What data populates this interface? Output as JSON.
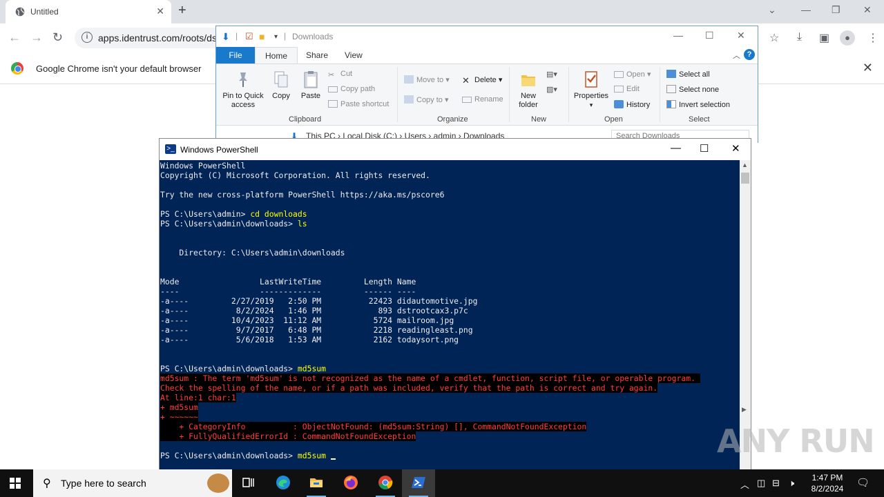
{
  "chrome": {
    "tab_title": "Untitled",
    "url": "apps.identrust.com/roots/ds",
    "infobar_message": "Google Chrome isn't your default browser"
  },
  "explorer": {
    "title": "Downloads",
    "tabs": {
      "file": "File",
      "home": "Home",
      "share": "Share",
      "view": "View"
    },
    "ribbon": {
      "clipboard": {
        "label": "Clipboard",
        "pin": "Pin to Quick access",
        "copy": "Copy",
        "paste": "Paste",
        "cut": "Cut",
        "copy_path": "Copy path",
        "paste_shortcut": "Paste shortcut"
      },
      "organize": {
        "label": "Organize",
        "move_to": "Move to",
        "copy_to": "Copy to",
        "delete": "Delete",
        "rename": "Rename"
      },
      "new": {
        "label": "New",
        "new_folder": "New folder"
      },
      "open": {
        "label": "Open",
        "properties": "Properties",
        "open": "Open",
        "edit": "Edit",
        "history": "History"
      },
      "select": {
        "label": "Select",
        "select_all": "Select all",
        "select_none": "Select none",
        "invert": "Invert selection"
      }
    },
    "address": "This PC  ›  Local Disk (C:)  ›  Users  ›  admin  ›  Downloads",
    "search_placeholder": "Search Downloads"
  },
  "powershell": {
    "title": "Windows PowerShell",
    "lines": [
      {
        "t": "Windows PowerShell"
      },
      {
        "t": "Copyright (C) Microsoft Corporation. All rights reserved."
      },
      {
        "t": ""
      },
      {
        "t": "Try the new cross-platform PowerShell https://aka.ms/pscore6"
      },
      {
        "t": ""
      },
      {
        "t": "PS C:\\Users\\admin> ",
        "c": "cd downloads"
      },
      {
        "t": "PS C:\\Users\\admin\\downloads> ",
        "c": "ls"
      },
      {
        "t": ""
      },
      {
        "t": ""
      },
      {
        "t": "    Directory: C:\\Users\\admin\\downloads"
      },
      {
        "t": ""
      },
      {
        "t": ""
      },
      {
        "t": "Mode                 LastWriteTime         Length Name"
      },
      {
        "t": "----                 -------------         ------ ----"
      },
      {
        "t": "-a----         2/27/2019   2:50 PM          22423 didautomotive.jpg"
      },
      {
        "t": "-a----          8/2/2024   1:46 PM            893 dstrootcax3.p7c"
      },
      {
        "t": "-a----         10/4/2023  11:12 AM           5724 mailroom.jpg"
      },
      {
        "t": "-a----          9/7/2017   6:48 PM           2218 readingleast.png"
      },
      {
        "t": "-a----          5/6/2018   1:53 AM           2162 todaysort.png"
      },
      {
        "t": ""
      },
      {
        "t": ""
      },
      {
        "t": "PS C:\\Users\\admin\\downloads> ",
        "c": "md5sum"
      },
      {
        "e": "md5sum : The term 'md5sum' is not recognized as the name of a cmdlet, function, script file, or operable program. "
      },
      {
        "e": "Check the spelling of the name, or if a path was included, verify that the path is correct and try again."
      },
      {
        "e": "At line:1 char:1"
      },
      {
        "e": "+ md5sum"
      },
      {
        "e": "+ ~~~~~~"
      },
      {
        "e": "    + CategoryInfo          : ObjectNotFound: (md5sum:String) [], CommandNotFoundException"
      },
      {
        "e": "    + FullyQualifiedErrorId : CommandNotFoundException"
      },
      {
        "t": ""
      },
      {
        "t": "PS C:\\Users\\admin\\downloads> ",
        "c": "md5sum ",
        "cursor": true
      }
    ]
  },
  "taskbar": {
    "search_placeholder": "Type here to search",
    "time": "1:47 PM",
    "date": "8/2/2024"
  },
  "watermark": "ANY RUN"
}
